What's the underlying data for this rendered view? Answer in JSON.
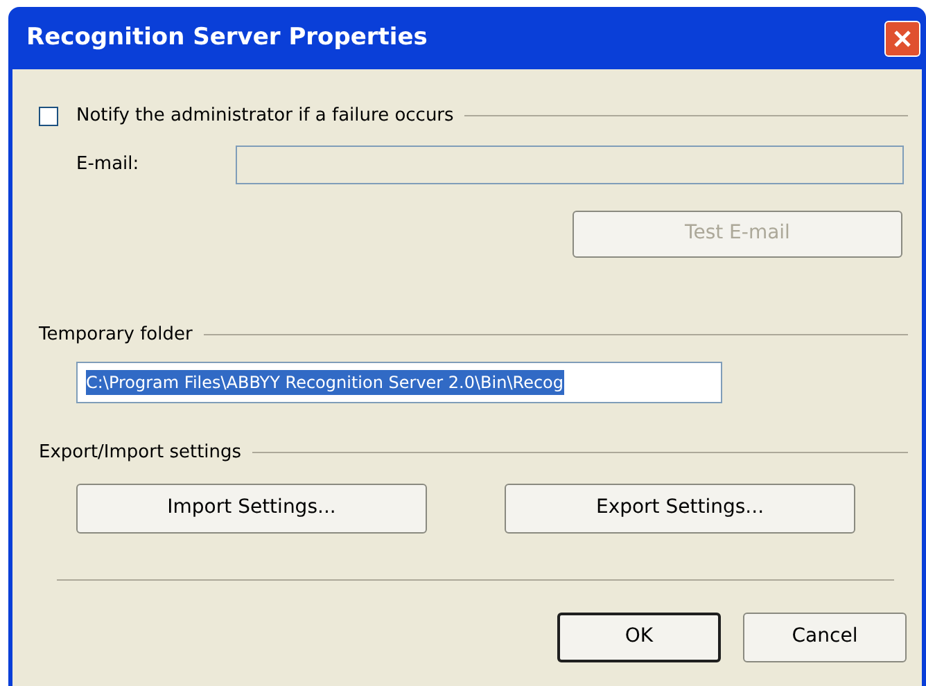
{
  "window": {
    "title": "Recognition Server Properties"
  },
  "notify": {
    "label": "Notify the administrator if a failure occurs",
    "checked": false
  },
  "email": {
    "label": "E-mail:",
    "disabled": true
  },
  "test_button": {
    "label": "Test E-mail",
    "disabled": true
  },
  "temp_folder": {
    "label": "Temporary folder",
    "value": "C:\\Program Files\\ABBYY Recognition Server 2.0\\Bin\\Recog",
    "selected": true
  },
  "export_import": {
    "label": "Export/Import settings",
    "buttons": [
      "Import Settings...",
      "Export Settings..."
    ]
  },
  "buttons": [
    {
      "label": "OK",
      "default": true
    },
    {
      "label": "Cancel",
      "default": false
    }
  ]
}
